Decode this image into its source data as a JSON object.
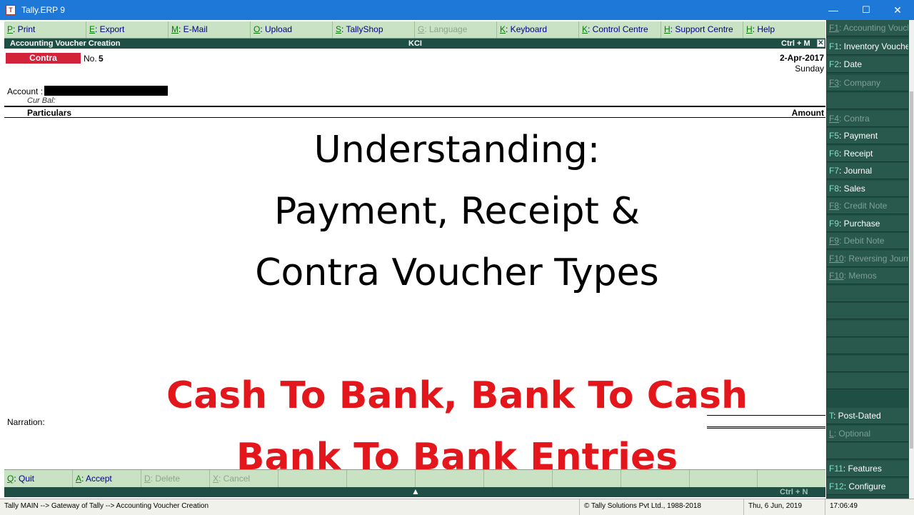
{
  "window": {
    "title": "Tally.ERP 9",
    "icon_text": "T",
    "minimize": "—",
    "maximize": "☐",
    "close": "✕"
  },
  "toolbar": [
    {
      "key": "P",
      "label": ": Print",
      "enabled": true
    },
    {
      "key": "E",
      "label": ": Export",
      "enabled": true
    },
    {
      "key": "M",
      "label": ": E-Mail",
      "enabled": true
    },
    {
      "key": "O",
      "label": ": Upload",
      "enabled": true
    },
    {
      "key": "S",
      "label": ": TallyShop",
      "enabled": true
    },
    {
      "key": "G",
      "label": ": Language",
      "enabled": false
    },
    {
      "key": "K",
      "label": ": Keyboard",
      "enabled": true
    },
    {
      "key": "K",
      "label": ": Control Centre",
      "enabled": true
    },
    {
      "key": "H",
      "label": ": Support Centre",
      "enabled": true
    },
    {
      "key": "H",
      "label": ": Help",
      "enabled": true
    }
  ],
  "header": {
    "title": "Accounting Voucher  Creation",
    "company": "KCI",
    "shortcut": "Ctrl + M",
    "close": "✕"
  },
  "voucher": {
    "type": "Contra",
    "no_label": "No.",
    "no": "5",
    "date": "2-Apr-2017",
    "day": "Sunday",
    "account_label": "Account :",
    "cur_bal_label": "Cur Bal:",
    "col_particulars": "Particulars",
    "col_amount": "Amount",
    "narration_label": "Narration:"
  },
  "overlay": {
    "line1": "Understanding:",
    "line2": "Payment, Receipt &",
    "line3": "Contra Voucher Types",
    "red_line1": "Cash To Bank, Bank To Cash",
    "red_line2": "Bank To Bank Entries"
  },
  "bottombar": [
    {
      "key": "Q",
      "label": ": Quit",
      "enabled": true
    },
    {
      "key": "A",
      "label": ": Accept",
      "enabled": true
    },
    {
      "key": "D",
      "label": ": Delete",
      "enabled": false
    },
    {
      "key": "X",
      "label": ": Cancel",
      "enabled": false
    },
    {
      "key": "",
      "label": "",
      "enabled": false
    },
    {
      "key": "",
      "label": "",
      "enabled": false
    },
    {
      "key": "",
      "label": "",
      "enabled": false
    },
    {
      "key": "",
      "label": "",
      "enabled": false
    },
    {
      "key": "",
      "label": "",
      "enabled": false
    },
    {
      "key": "",
      "label": "",
      "enabled": false
    },
    {
      "key": "",
      "label": "",
      "enabled": false
    },
    {
      "key": "",
      "label": "",
      "enabled": false
    }
  ],
  "scroll_strip": {
    "arrow": "▲",
    "shortcut": "Ctrl + N"
  },
  "statusbar": {
    "path": "Tally MAIN --> Gateway of Tally --> Accounting Voucher  Creation",
    "copyright": "© Tally Solutions Pvt Ltd., 1988-2018",
    "date": "Thu, 6 Jun, 2019",
    "time": "17:06:49"
  },
  "sidepanel": [
    {
      "key": "F1",
      "label": ": Accounting Vouchers",
      "enabled": false
    },
    {
      "key": "F1",
      "label": ": Inventory Vouchers",
      "enabled": true
    },
    {
      "key": "F2",
      "label": ": Date",
      "enabled": true
    },
    {
      "key": "F3",
      "label": ": Company",
      "enabled": false
    },
    {
      "key": "",
      "label": "",
      "enabled": false
    },
    {
      "key": "F4",
      "label": ": Contra",
      "enabled": false
    },
    {
      "key": "F5",
      "label": ": Payment",
      "enabled": true
    },
    {
      "key": "F6",
      "label": ": Receipt",
      "enabled": true
    },
    {
      "key": "F7",
      "label": ": Journal",
      "enabled": true
    },
    {
      "key": "F8",
      "label": ": Sales",
      "enabled": true
    },
    {
      "key": "F8",
      "label": ": Credit Note",
      "enabled": false
    },
    {
      "key": "F9",
      "label": ": Purchase",
      "enabled": true
    },
    {
      "key": "F9",
      "label": ": Debit Note",
      "enabled": false
    },
    {
      "key": "F10",
      "label": ": Reversing Journal",
      "enabled": false
    },
    {
      "key": "F10",
      "label": ": Memos",
      "enabled": false
    },
    {
      "key": "",
      "label": "",
      "enabled": false
    },
    {
      "key": "",
      "label": "",
      "enabled": false
    },
    {
      "key": "",
      "label": "",
      "enabled": false
    },
    {
      "key": "",
      "label": "",
      "enabled": false
    },
    {
      "key": "",
      "label": "",
      "enabled": false
    },
    {
      "key": "",
      "label": "",
      "enabled": false
    },
    {
      "key": "T",
      "label": ": Post-Dated",
      "enabled": true
    },
    {
      "key": "L",
      "label": ": Optional",
      "enabled": false
    },
    {
      "key": "",
      "label": "",
      "enabled": false
    },
    {
      "key": "F11",
      "label": ": Features",
      "enabled": true
    },
    {
      "key": "F12",
      "label": ": Configure",
      "enabled": true
    }
  ]
}
